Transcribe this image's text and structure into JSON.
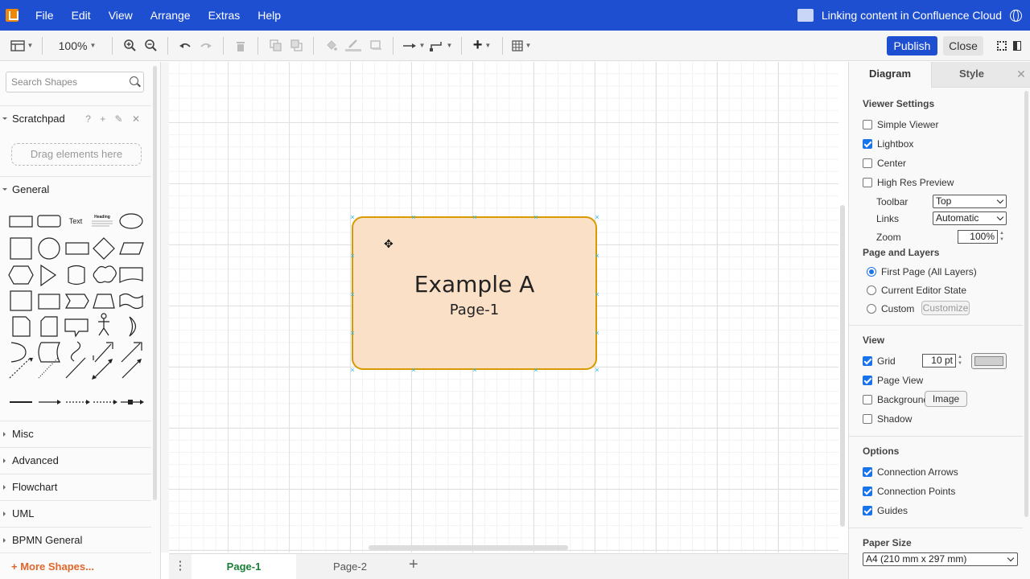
{
  "menubar": {
    "items": [
      "File",
      "Edit",
      "View",
      "Arrange",
      "Extras",
      "Help"
    ],
    "title": "Linking content in Confluence Cloud"
  },
  "toolbar": {
    "zoom": "100%",
    "publish_label": "Publish",
    "close_label": "Close"
  },
  "sidebar": {
    "search_placeholder": "Search Shapes",
    "scratchpad_label": "Scratchpad",
    "scratchpad_actions": "? + ✎ ✕",
    "drag_hint": "Drag elements here",
    "general_label": "General",
    "text_shape_label": "Text",
    "heading_shape_label": "Heading",
    "sections": [
      "Misc",
      "Advanced",
      "Flowchart",
      "UML",
      "BPMN General"
    ],
    "more_shapes": "More Shapes..."
  },
  "canvas": {
    "shape_title": "Example A",
    "shape_subtitle": "Page-1",
    "shape_fill": "#fae0c6",
    "shape_stroke": "#d79b00"
  },
  "pages": {
    "tabs": [
      "Page-1",
      "Page-2"
    ],
    "active": "Page-1"
  },
  "format_panel": {
    "tab_diagram": "Diagram",
    "tab_style": "Style",
    "viewer_settings_heading": "Viewer Settings",
    "simple_viewer": {
      "label": "Simple Viewer",
      "checked": false
    },
    "lightbox": {
      "label": "Lightbox",
      "checked": true
    },
    "center": {
      "label": "Center",
      "checked": false
    },
    "high_res_preview": {
      "label": "High Res Preview",
      "checked": false
    },
    "toolbar_label": "Toolbar",
    "toolbar_value": "Top",
    "links_label": "Links",
    "links_value": "Automatic",
    "zoom_label": "Zoom",
    "zoom_value": "100%",
    "page_layers_heading": "Page and Layers",
    "radio_first_page": "First Page (All Layers)",
    "radio_current_editor": "Current Editor State",
    "radio_custom": "Custom",
    "radio_selected": "First Page (All Layers)",
    "customize_button": "Customize",
    "view_heading": "View",
    "grid": {
      "label": "Grid",
      "checked": true,
      "size": "10 pt"
    },
    "page_view": {
      "label": "Page View",
      "checked": true
    },
    "background": {
      "label": "Background",
      "checked": false
    },
    "image_button": "Image",
    "shadow": {
      "label": "Shadow",
      "checked": false
    },
    "options_heading": "Options",
    "connection_arrows": {
      "label": "Connection Arrows",
      "checked": true
    },
    "connection_points": {
      "label": "Connection Points",
      "checked": true
    },
    "guides": {
      "label": "Guides",
      "checked": true
    },
    "paper_size_heading": "Paper Size",
    "paper_size_value": "A4 (210 mm x 297 mm)"
  },
  "colors": {
    "brand_blue": "#1f4fd1",
    "accent_orange": "#f08705",
    "active_tab_green": "#1a7f37"
  }
}
